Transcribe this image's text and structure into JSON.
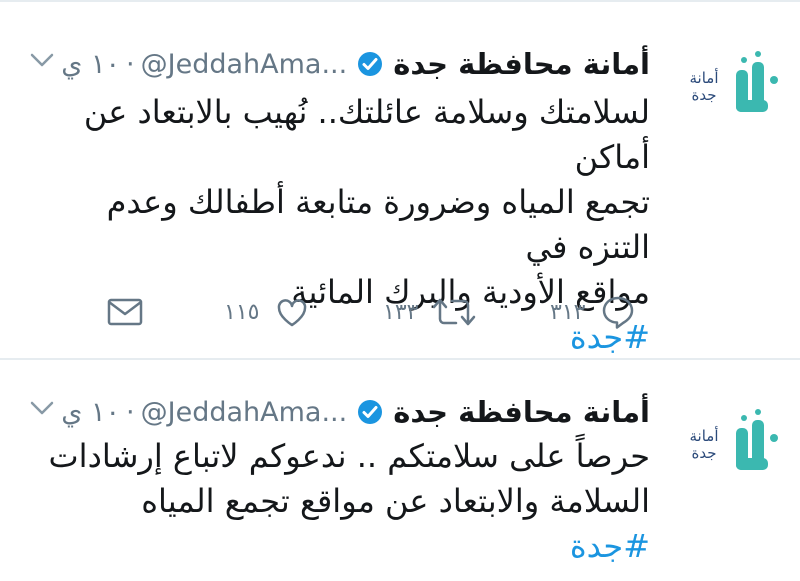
{
  "tweets": [
    {
      "avatar_text": "أمانة\nجدة",
      "name": "أمانة محافظة جدة",
      "handle": "@JeddahAma...",
      "separator": "·",
      "time": "١٠ ي",
      "lines": [
        "لسلامتك وسلامة عائلتك.. نُهيب بالابتعاد عن أماكن",
        "تجمع المياه وضرورة متابعة أطفالك وعدم التنزه في",
        "مواقع الأودية والبرك المائية"
      ],
      "hashtag": "#جدة",
      "reply_count": "٣١٣",
      "retweet_count": "١٣٣",
      "like_count": "١١٥"
    },
    {
      "avatar_text": "أمانة\nجدة",
      "name": "أمانة محافظة جدة",
      "handle": "@JeddahAma...",
      "separator": "·",
      "time": "١٠ ي",
      "lines": [
        "حرصاً على سلامتكم .. ندعوكم لاتباع إرشادات",
        "السلامة والابتعاد عن مواقع تجمع المياه"
      ],
      "hashtag": "#جدة"
    }
  ],
  "colors": {
    "accent": "#1b95e0",
    "muted": "#657786",
    "divider": "#e6ecf0",
    "logo_teal": "#3bb8b0",
    "logo_navy": "#2b4a7a"
  }
}
